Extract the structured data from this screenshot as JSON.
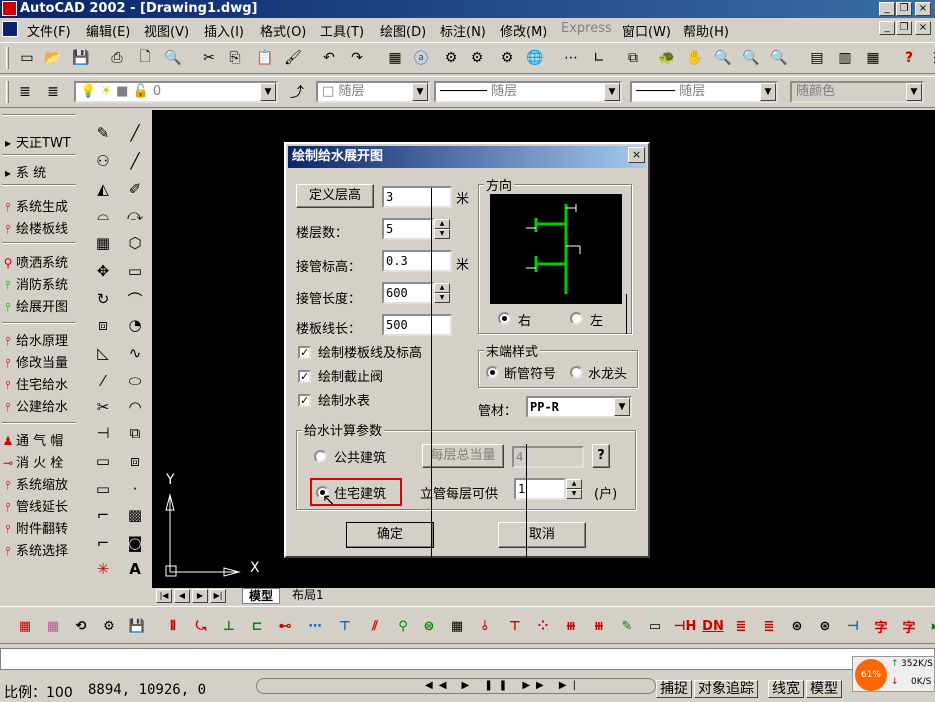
{
  "window": {
    "title": "AutoCAD 2002 - [Drawing1.dwg]",
    "controls": {
      "minimize": "_",
      "restore": "❐",
      "close": "×"
    }
  },
  "menu": [
    "文件(F)",
    "编辑(E)",
    "视图(V)",
    "插入(I)",
    "格式(O)",
    "工具(T)",
    "绘图(D)",
    "标注(N)",
    "修改(M)",
    "Express",
    "窗口(W)",
    "帮助(H)"
  ],
  "layer_toolbar": {
    "layer_value": "0",
    "color_value": "随层",
    "linetype_value": "随层",
    "lineweight_value": "随层",
    "plotstyle_value": "随颜色"
  },
  "left_panel": {
    "items": [
      {
        "label": "天正TWT",
        "icon": "arrow-icon"
      },
      {
        "label": "系    统",
        "icon": "arrow-icon"
      },
      {
        "label": "系统生成",
        "icon": "pipe-icon"
      },
      {
        "label": "绘楼板线",
        "icon": "pipe-icon"
      },
      {
        "label": "喷洒系统",
        "icon": "sprinkler-icon"
      },
      {
        "label": "消防系统",
        "icon": "fire-icon"
      },
      {
        "label": "绘展开图",
        "icon": "pipe-icon"
      },
      {
        "label": "给水原理",
        "icon": "pipe-icon"
      },
      {
        "label": "修改当量",
        "icon": "pipe-icon"
      },
      {
        "label": "住宅给水",
        "icon": "pipe-icon"
      },
      {
        "label": "公建给水",
        "icon": "pipe-icon"
      },
      {
        "label": "通 气 帽",
        "icon": "cap-icon"
      },
      {
        "label": "消 火 栓",
        "icon": "hydrant-icon"
      },
      {
        "label": "系统缩放",
        "icon": "scale-icon"
      },
      {
        "label": "管线延长",
        "icon": "extend-icon"
      },
      {
        "label": "附件翻转",
        "icon": "flip-icon"
      },
      {
        "label": "系统选择",
        "icon": "select-icon"
      }
    ]
  },
  "tabs": {
    "model": "模型",
    "layout1": "布局1"
  },
  "axes": {
    "x": "X",
    "y": "Y"
  },
  "dialog": {
    "title": "绘制给水展开图",
    "close": "×",
    "define_floor_height_button": "定义层高",
    "floor_height_value": "3",
    "unit_marker": "米",
    "floor_count_label": "楼层数：",
    "floor_count_value": "5",
    "pipe_elevation_label": "接管标高：",
    "pipe_elevation_value": "0.3",
    "pipe_length_label": "接管长度：",
    "pipe_length_value": "600",
    "slab_line_length_label": "楼板线长：",
    "slab_line_length_value": "500",
    "check_slab_lines": {
      "label": "绘制楼板线及标高",
      "checked": true
    },
    "check_stop_valve": {
      "label": "绘制截止阀",
      "checked": true
    },
    "check_water_meter": {
      "label": "绘制水表",
      "checked": true
    },
    "direction_group": "方向",
    "direction_right": "右",
    "direction_left": "左",
    "direction_selected": "右",
    "end_style_group": "末端样式",
    "end_break": "断管符号",
    "end_faucet": "水龙头",
    "end_selected": "断管符号",
    "pipe_material_label": "管材：",
    "pipe_material_value": "PP-R",
    "calc_group": "给水计算参数",
    "public_building": "公共建筑",
    "per_floor_equiv_button": "每层总当量",
    "per_floor_equiv_value": "4",
    "help_button": "?",
    "residential_building": "住宅建筑",
    "building_selected": "住宅建筑",
    "riser_supply_label": "立管每层可供",
    "riser_supply_value": "1",
    "household_unit": "(户)",
    "ok_button": "确定",
    "cancel_button": "取消"
  },
  "status": {
    "scale": "比例：100",
    "coords": "8894, 10926, 0",
    "snap": "捕捉",
    "otrack": "对象追踪",
    "lwt": "线宽",
    "model": "模型"
  },
  "net_widget": {
    "cpu": "61%",
    "up": "352K/S",
    "down": "0K/S"
  },
  "colors": {
    "title_blue": "#0a246a",
    "canvas": "#000000",
    "preview_green": "#00cc00",
    "highlight_red": "#e00000"
  }
}
